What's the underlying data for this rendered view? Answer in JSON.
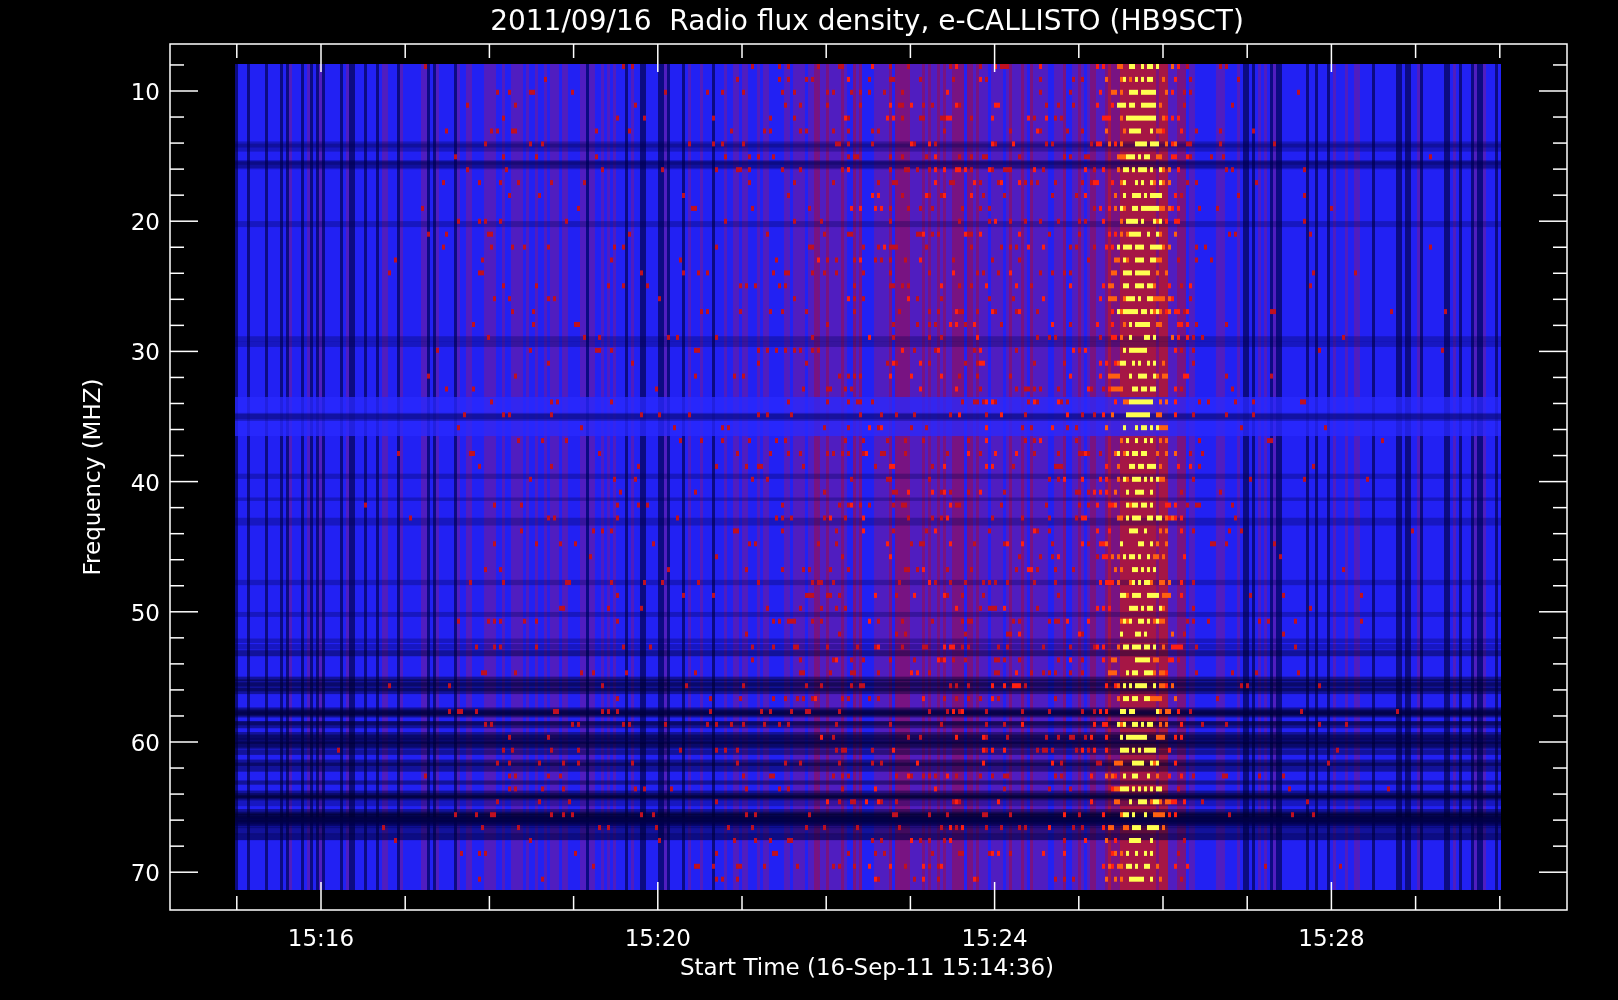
{
  "title": "2011/09/16  Radio flux density, e-CALLISTO (HB9SCT)",
  "y_axis": {
    "label": "Frequency (MHZ)",
    "ticks": [
      "10",
      "20",
      "30",
      "40",
      "50",
      "60",
      "70"
    ]
  },
  "x_axis": {
    "label": "Start Time (16-Sep-11 15:14:36)",
    "ticks": [
      "15:16",
      "15:20",
      "15:24",
      "15:28"
    ]
  }
}
